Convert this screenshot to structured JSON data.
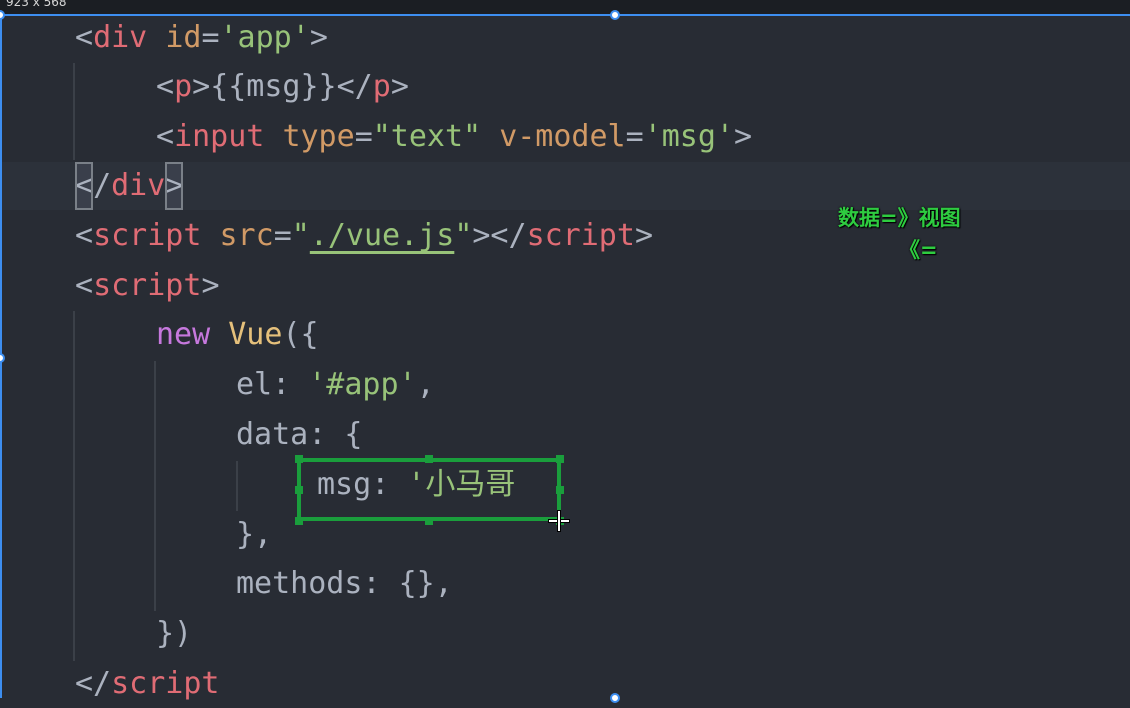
{
  "capture": {
    "dimensions_label": "923 x 568"
  },
  "code": {
    "l1": {
      "open": "<",
      "tag": "div",
      "attr": "id",
      "eq": "=",
      "val": "'app'",
      "close": ">"
    },
    "l2": {
      "open": "<",
      "tag": "p",
      "close": ">",
      "mustache": "{{msg}}",
      "end_open": "</",
      "end_tag": "p",
      "end_close": ">"
    },
    "l3": {
      "open": "<",
      "tag": "input",
      "attr1": "type",
      "eq1": "=",
      "val1": "\"text\"",
      "attr2": "v-model",
      "eq2": "=",
      "val2": "'msg'",
      "close": ">"
    },
    "l4": {
      "open": "<",
      "slash": "/",
      "tag": "div",
      "close": ">"
    },
    "l5": {
      "open": "<",
      "tag": "script",
      "attr": "src",
      "eq": "=",
      "q1": "\"",
      "src": "./vue.js",
      "q2": "\"",
      "mid": "></",
      "end_tag": "script",
      "close": ">"
    },
    "l6": {
      "open": "<",
      "tag": "script",
      "close": ">"
    },
    "l7": {
      "kw": "new",
      "cls": "Vue",
      "punc": "({"
    },
    "l8": {
      "key": "el",
      "colon": ":",
      "val": "'#app'",
      "comma": ","
    },
    "l9": {
      "key": "data",
      "colon": ":",
      "brace": "{"
    },
    "l10": {
      "key": "msg",
      "colon": ":",
      "val": "'小马哥"
    },
    "l11": {
      "text": "},"
    },
    "l12": {
      "key": "methods",
      "colon": ":",
      "val": "{},"
    },
    "l13": {
      "text": "})"
    },
    "l14": {
      "open": "</",
      "tag": "script"
    }
  },
  "annotation": {
    "line1": "数据=》视图",
    "line2": "《="
  },
  "colors": {
    "highlight_box": "#1a9e3c",
    "annotation_text": "#2ecc40",
    "selection": "#3d8ef0"
  }
}
